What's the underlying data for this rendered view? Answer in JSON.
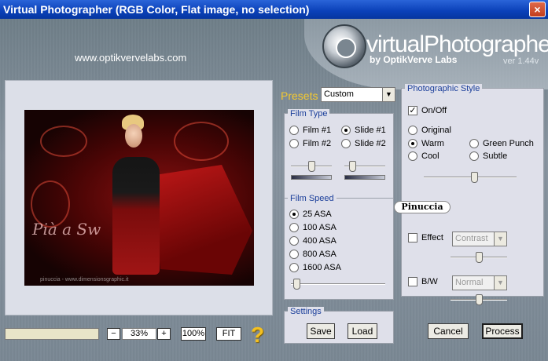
{
  "window": {
    "title": "Virtual Photographer (RGB Color, Flat image, no selection)",
    "close_symbol": "×"
  },
  "header": {
    "url": "www.optikvervelabs.com",
    "brand": "virtualPhotographer",
    "brand_sub": "by OptikVerve Labs",
    "version": "ver 1.44v"
  },
  "preview": {
    "signature_text": "Pià a Sw",
    "credit": "pinuccia - www.dimensionsgraphic.it"
  },
  "zoom": {
    "minus": "−",
    "value": "33%",
    "plus": "+",
    "full_label": "100%",
    "fit_label": "FIT",
    "help": "?"
  },
  "presets": {
    "label": "Presets",
    "value": "Custom"
  },
  "film_type": {
    "title": "Film Type",
    "options": [
      "Film #1",
      "Slide #1",
      "Film #2",
      "Slide #2"
    ],
    "selected": "Slide #1",
    "slider1_value": 0.5,
    "slider2_value": 0.15
  },
  "film_speed": {
    "title": "Film Speed",
    "options": [
      "25 ASA",
      "100 ASA",
      "400 ASA",
      "800 ASA",
      "1600 ASA"
    ],
    "selected": "25 ASA",
    "slider_value": 0.03
  },
  "settings": {
    "title": "Settings",
    "save_label": "Save",
    "load_label": "Load"
  },
  "photo_style": {
    "title": "Photographic Style",
    "onoff_label": "On/Off",
    "onoff_checked": true,
    "options": [
      "Original",
      "Warm",
      "Green Punch",
      "Cool",
      "Subtle"
    ],
    "selected": "Warm",
    "style_slider_value": 0.55,
    "badge": "Pinuccia",
    "effect_label": "Effect",
    "effect_value": "Contrast",
    "effect_slider_value": 0.5,
    "bw_label": "B/W",
    "bw_value": "Normal",
    "bw_slider_value": 0.5
  },
  "actions": {
    "cancel_label": "Cancel",
    "process_label": "Process"
  },
  "colors": {
    "titlebar": "#0a40b8",
    "presets_label": "#f3c830",
    "group_title": "#1a3e9a",
    "help": "#f4c020"
  }
}
